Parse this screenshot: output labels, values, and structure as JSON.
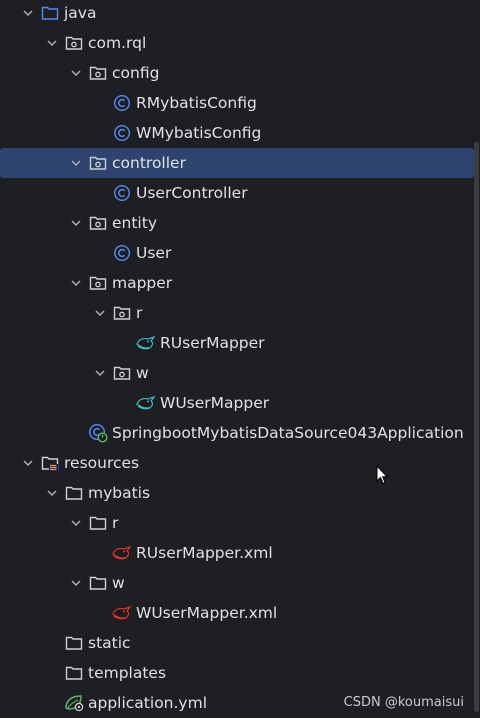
{
  "tree": [
    {
      "label": "java",
      "icon": "source-folder-icon",
      "expanded": true
    },
    {
      "label": "com.rql",
      "icon": "package-icon",
      "expanded": true
    },
    {
      "label": "config",
      "icon": "package-icon",
      "expanded": true
    },
    {
      "label": "RMybatisConfig",
      "icon": "java-class-icon"
    },
    {
      "label": "WMybatisConfig",
      "icon": "java-class-icon"
    },
    {
      "label": "controller",
      "icon": "package-icon",
      "expanded": true,
      "selected": true
    },
    {
      "label": "UserController",
      "icon": "java-class-icon"
    },
    {
      "label": "entity",
      "icon": "package-icon",
      "expanded": true
    },
    {
      "label": "User",
      "icon": "java-class-icon"
    },
    {
      "label": "mapper",
      "icon": "package-icon",
      "expanded": true
    },
    {
      "label": "r",
      "icon": "package-icon",
      "expanded": true
    },
    {
      "label": "RUserMapper",
      "icon": "mybatis-mapper-icon"
    },
    {
      "label": "w",
      "icon": "package-icon",
      "expanded": true
    },
    {
      "label": "WUserMapper",
      "icon": "mybatis-mapper-icon"
    },
    {
      "label": "SpringbootMybatisDataSource043Application",
      "icon": "spring-boot-class-icon"
    },
    {
      "label": "resources",
      "icon": "resources-folder-icon",
      "expanded": true
    },
    {
      "label": "mybatis",
      "icon": "folder-icon",
      "expanded": true
    },
    {
      "label": "r",
      "icon": "folder-icon",
      "expanded": true
    },
    {
      "label": "RUserMapper.xml",
      "icon": "mybatis-xml-icon"
    },
    {
      "label": "w",
      "icon": "folder-icon",
      "expanded": true
    },
    {
      "label": "WUserMapper.xml",
      "icon": "mybatis-xml-icon"
    },
    {
      "label": "static",
      "icon": "folder-icon"
    },
    {
      "label": "templates",
      "icon": "folder-icon"
    },
    {
      "label": "application.yml",
      "icon": "spring-config-icon"
    }
  ],
  "watermark": "CSDN @koumaisui",
  "colors": {
    "background": "#1e1f22",
    "selection": "#2e436e",
    "text": "#dfe1e5",
    "class_icon": "#548af7",
    "folder_icon": "#ced0d6",
    "source_folder_icon": "#548af7",
    "spring": "#5fb865",
    "mapper_red": "#e0332e",
    "mapper_teal": "#3fb8c7"
  }
}
